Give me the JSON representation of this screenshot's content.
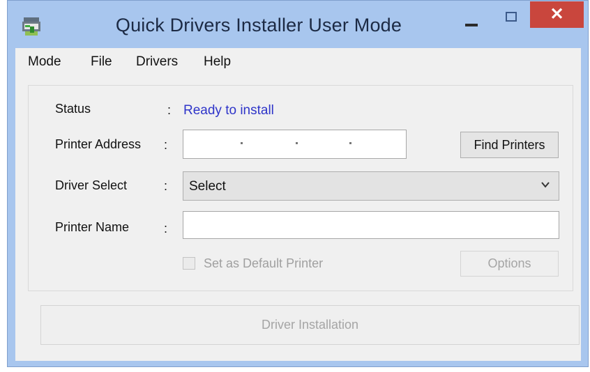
{
  "window": {
    "title": "Quick Drivers Installer User Mode",
    "close_glyph": "✕"
  },
  "menu": [
    "Mode",
    "File",
    "Drivers",
    "Help"
  ],
  "form": {
    "status_label": "Status",
    "status_value": "Ready to install",
    "printer_address_label": "Printer Address",
    "driver_select_label": "Driver Select",
    "driver_select_value": "Select",
    "printer_name_label": "Printer Name",
    "colon": ":",
    "find_printers_label": "Find Printers",
    "default_printer_label": "Set as Default Printer",
    "default_printer_checked": false,
    "options_label": "Options",
    "driver_installation_label": "Driver Installation"
  },
  "colors": {
    "status_value": "#2f35c9",
    "close_button": "#c9463d",
    "window_frame": "#a8c6ee",
    "disabled_text": "#a5a5a5"
  },
  "icons": [
    "app-icon",
    "minimize-icon",
    "maximize-icon",
    "close-icon",
    "chevron-down-icon"
  ]
}
